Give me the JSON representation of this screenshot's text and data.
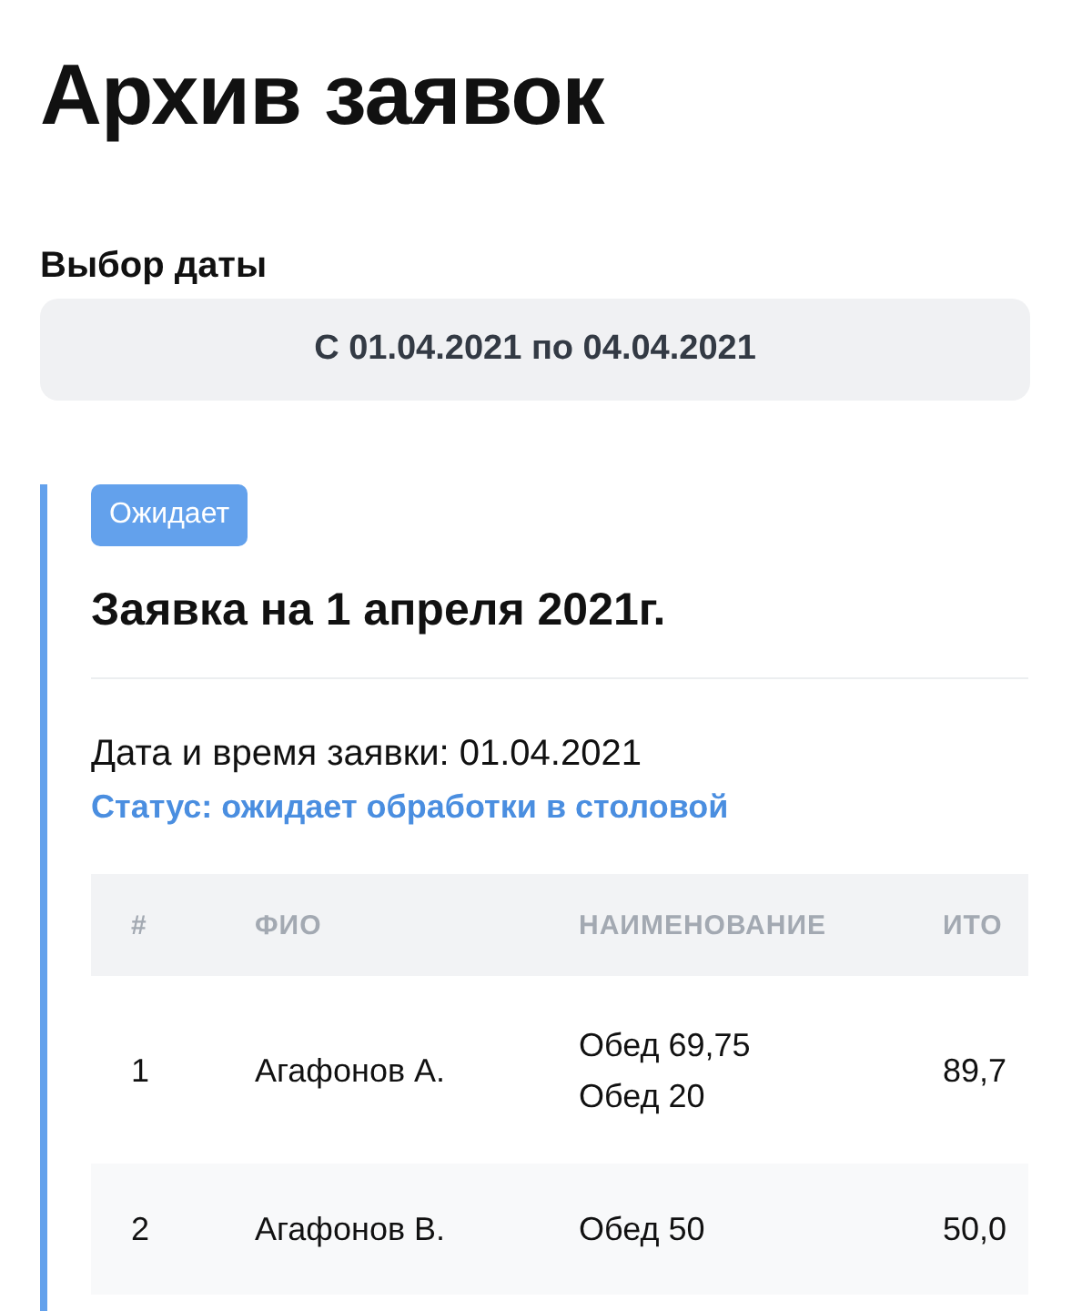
{
  "title": "Архив заявок",
  "date_picker": {
    "label": "Выбор даты",
    "value": "С 01.04.2021 по 04.04.2021"
  },
  "order": {
    "badge": "Ожидает",
    "title": "Заявка на 1 апреля 2021г.",
    "date_line": "Дата и время заявки: 01.04.2021",
    "status_line": "Статус: ожидает обработки в столовой",
    "table": {
      "columns": [
        "#",
        "ФИО",
        "НАИМЕНОВАНИЕ",
        "ИТО"
      ],
      "rows": [
        {
          "num": "1",
          "name": "Агафонов А.",
          "items": [
            "Обед 69,75",
            "Обед 20"
          ],
          "total": "89,7"
        },
        {
          "num": "2",
          "name": "Агафонов В.",
          "items": [
            "Обед 50"
          ],
          "total": "50,0"
        }
      ]
    }
  }
}
